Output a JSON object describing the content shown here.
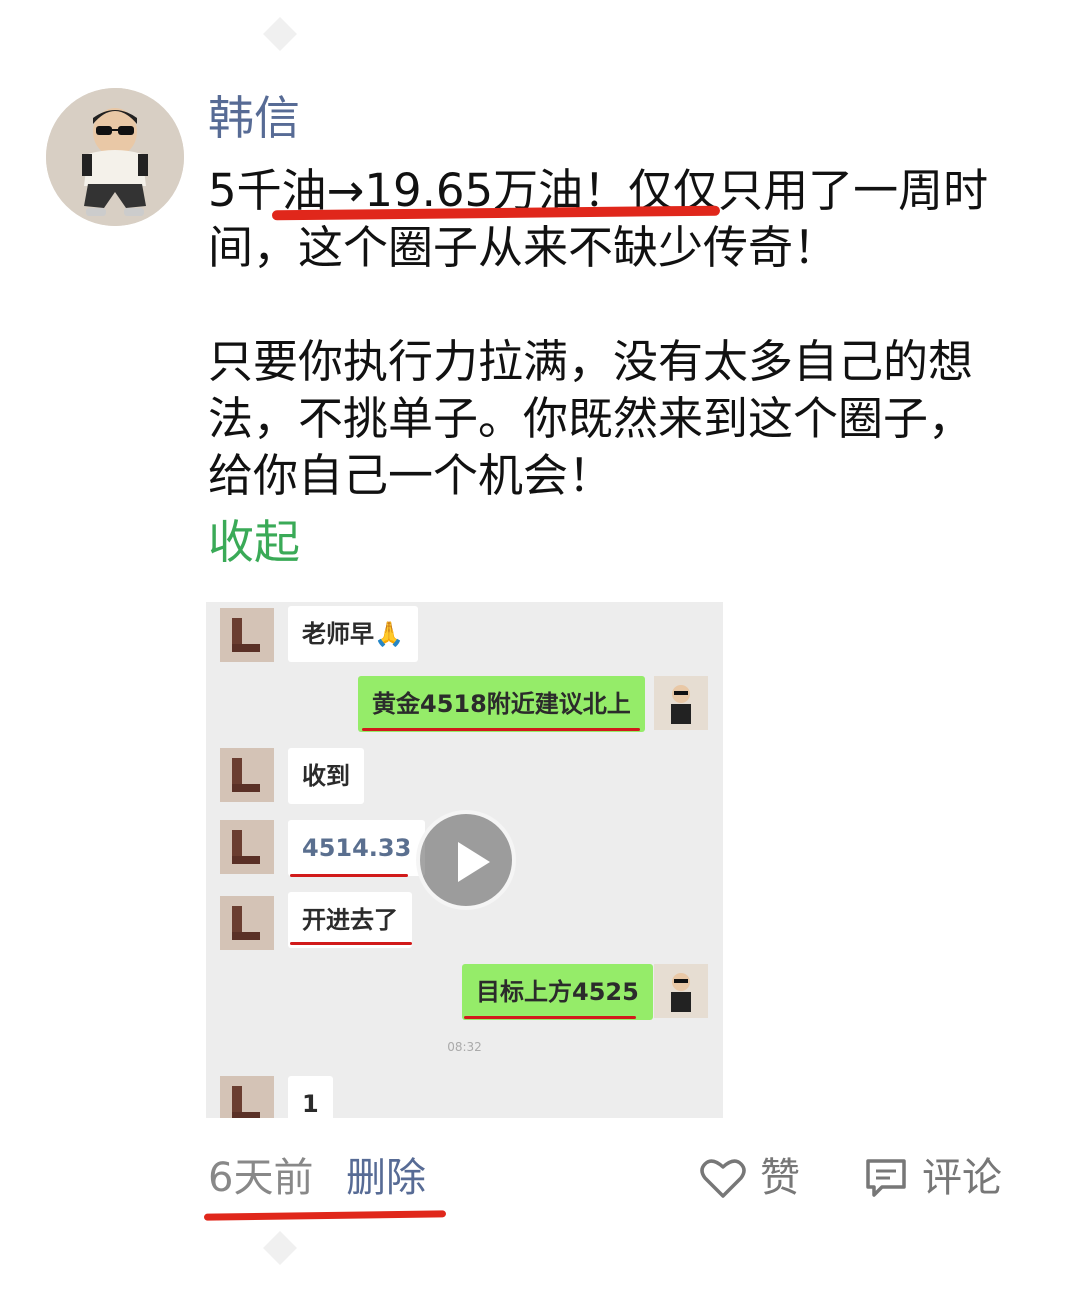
{
  "post": {
    "author": "韩信",
    "text": "5千油→19.65万油！仅仅只用了一周时间，这个圈子从来不缺少传奇！\n\n只要你执行力拉满，没有太多自己的想法，不挑单子。你既然来到这个圈子，给你自己一个机会！",
    "collapse_label": "收起",
    "time": "6天前",
    "delete_label": "删除",
    "like_label": "赞",
    "comment_label": "评论"
  },
  "video": {
    "messages": [
      {
        "side": "left",
        "text": "老师早🙏"
      },
      {
        "side": "right",
        "text": "黄金4518附近建议北上"
      },
      {
        "side": "left",
        "text": "收到"
      },
      {
        "side": "left",
        "text": "4514.33"
      },
      {
        "side": "left",
        "text": "开进去了"
      },
      {
        "side": "right",
        "text": "目标上方4525"
      },
      {
        "side": "left",
        "text": "1"
      }
    ],
    "time_label": "08:32"
  },
  "colors": {
    "author_name": "#576b95",
    "collapse_link": "#3aaa57",
    "highlight_underline": "#e0271b",
    "chat_right_bubble": "#95ec69"
  },
  "icons": [
    "play-icon",
    "heart-icon",
    "comment-icon"
  ]
}
